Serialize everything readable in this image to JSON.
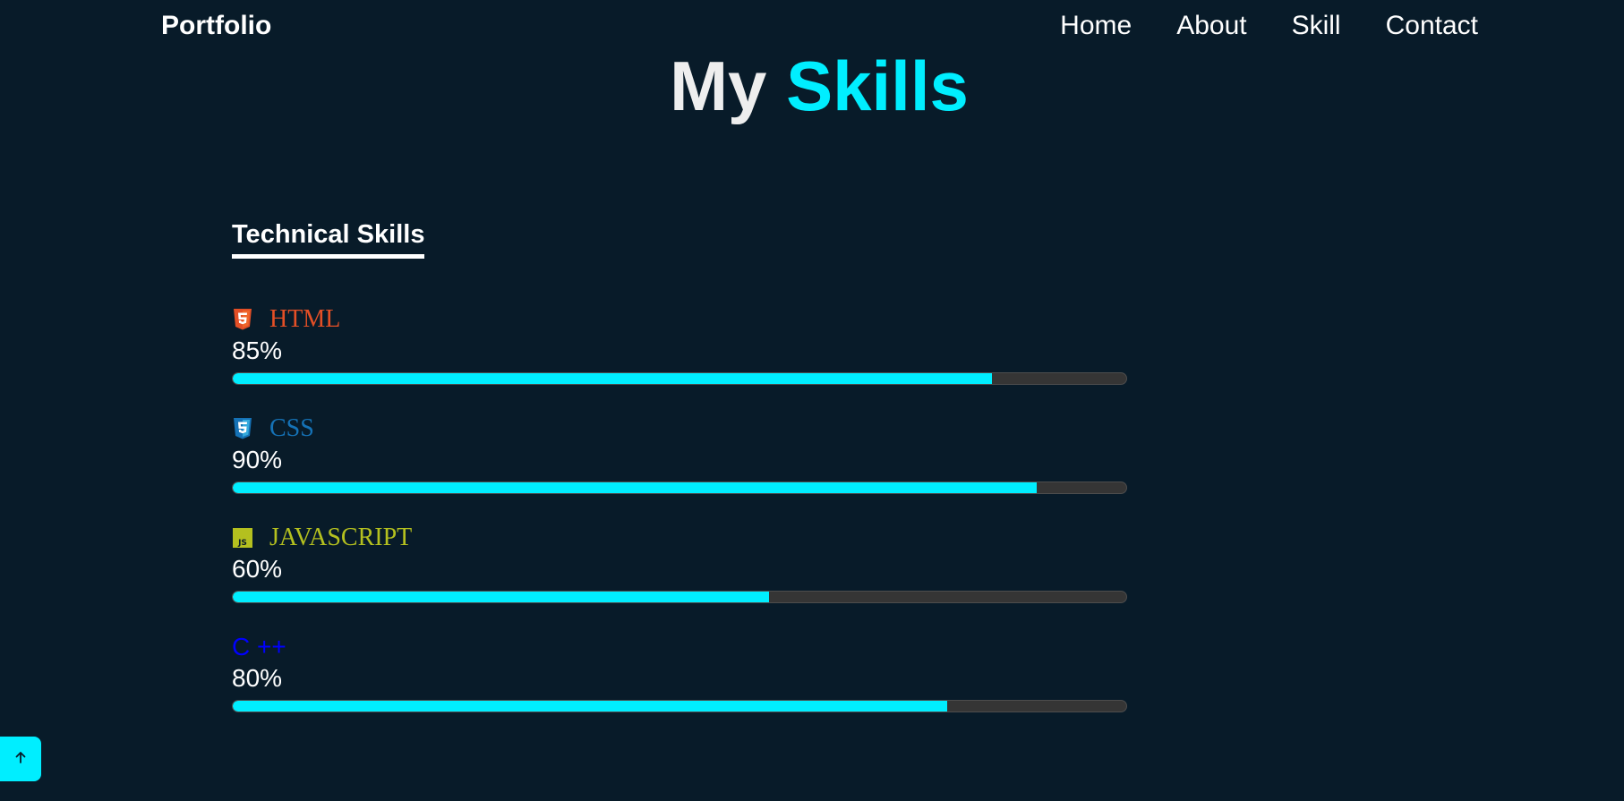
{
  "theme": {
    "background": "#081b29",
    "accent": "#00eeff"
  },
  "navbar": {
    "logo": "Portfolio",
    "links": [
      {
        "label": "Home"
      },
      {
        "label": "About"
      },
      {
        "label": "Skill"
      },
      {
        "label": "Contact"
      }
    ]
  },
  "heading": {
    "word1": "My",
    "word2": "Skills"
  },
  "section": {
    "title": "Technical Skills"
  },
  "skills": [
    {
      "name": "HTML",
      "icon": "html5-icon",
      "color": "#e34f26",
      "percent_label": "85%",
      "percent": 85
    },
    {
      "name": "CSS",
      "icon": "css3-icon",
      "color": "#1572b6",
      "percent_label": "90%",
      "percent": 90
    },
    {
      "name": "JAVASCRIPT",
      "icon": "javascript-icon",
      "color": "#b4c01f",
      "percent_label": "60%",
      "percent": 60
    },
    {
      "name": "C ++",
      "icon": "",
      "color": "#0000ff",
      "percent_label": "80%",
      "percent": 80
    }
  ],
  "scroll_top": {
    "icon": "arrow-up-icon"
  }
}
